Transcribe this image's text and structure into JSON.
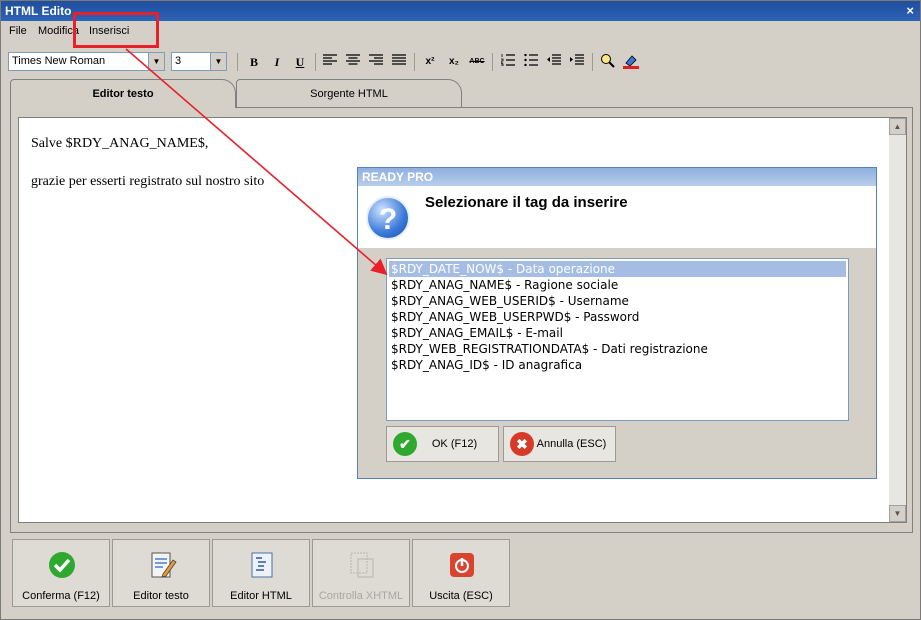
{
  "window": {
    "title": "HTML Edito",
    "close_glyph": "×"
  },
  "menu": {
    "file": "File",
    "modifica": "Modifica",
    "inserisci": "Inserisci"
  },
  "toolbar": {
    "font_name": "Times New Roman",
    "font_size": "3",
    "bold": "B",
    "italic": "I",
    "underline": "U",
    "superscript": "x²",
    "subscript": "x₂",
    "spellcheck": "ABC"
  },
  "tabs": {
    "editor": "Editor testo",
    "source": "Sorgente HTML"
  },
  "editor": {
    "line1": "Salve $RDY_ANAG_NAME$,",
    "line2": "grazie per esserti registrato sul nostro sito"
  },
  "dialog": {
    "title": "READY PRO",
    "prompt": "Selezionare il tag da inserire",
    "icon": "?",
    "items": [
      "$RDY_DATE_NOW$ - Data operazione",
      "$RDY_ANAG_NAME$ - Ragione sociale",
      "$RDY_ANAG_WEB_USERID$ - Username",
      "$RDY_ANAG_WEB_USERPWD$ - Password",
      "$RDY_ANAG_EMAIL$ - E-mail",
      "$RDY_WEB_REGISTRATIONDATA$ - Dati registrazione",
      "$RDY_ANAG_ID$ - ID anagrafica"
    ],
    "selected_index": 0,
    "ok_label": "OK (F12)",
    "cancel_label": "Annulla (ESC)"
  },
  "bottom_buttons": {
    "confirm": "Conferma (F12)",
    "editor_text": "Editor testo",
    "editor_html": "Editor HTML",
    "check_xhtml": "Controlla XHTML",
    "exit": "Uscita (ESC)"
  },
  "colors": {
    "annotation": "#e8202a",
    "selection": "#a6bde3",
    "title_bar": "#1f4e9c"
  }
}
